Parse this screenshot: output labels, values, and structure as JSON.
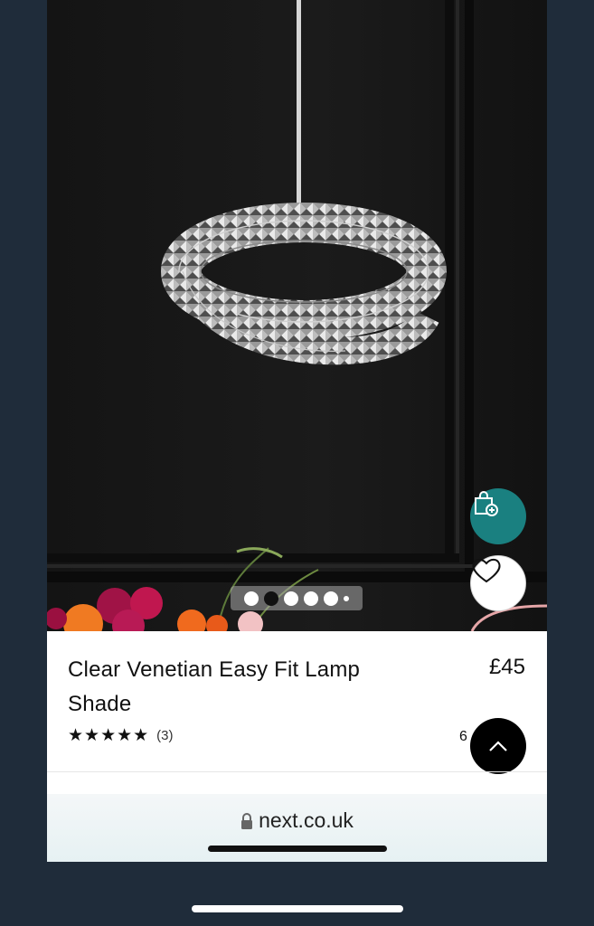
{
  "product": {
    "title": "Clear Venetian Easy Fit Lamp Shade",
    "price": "£45",
    "rating_stars": "★★★★★",
    "review_count": "(3)",
    "partial_text": "6"
  },
  "carousel": {
    "total_slides": 6,
    "active_slide": 2
  },
  "browser": {
    "url": "next.co.uk"
  },
  "colors": {
    "accent": "#1a8080",
    "background": "#1f2c3a",
    "image_bg": "#151515"
  },
  "icons": {
    "add_to_bag": "shopping-bag-plus-icon",
    "wishlist": "heart-icon",
    "back_to_top": "chevron-up-icon",
    "secure": "lock-icon"
  }
}
